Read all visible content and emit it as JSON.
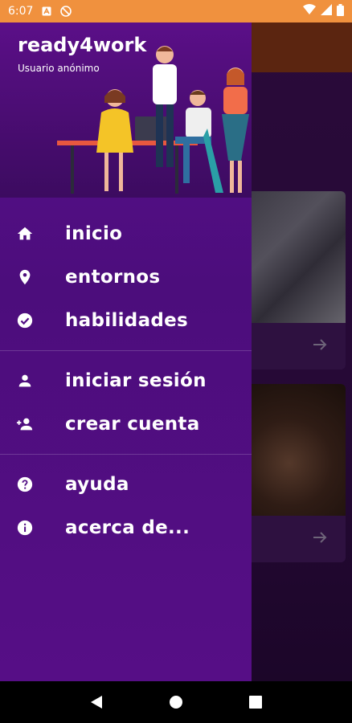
{
  "status_bar": {
    "time": "6:07",
    "left_icons": [
      "sim-a-icon",
      "no-disturb-icon"
    ],
    "right_icons": [
      "wifi-icon",
      "signal-icon",
      "battery-icon"
    ],
    "bg_color": "#f0913e"
  },
  "drawer": {
    "app_title": "ready4work",
    "user_label": "Usuario anónimo",
    "sections": [
      [
        {
          "label": "inicio",
          "icon": "home-icon"
        },
        {
          "label": "entornos",
          "icon": "location-pin-icon"
        },
        {
          "label": "habilidades",
          "icon": "check-circle-icon"
        }
      ],
      [
        {
          "label": "iniciar sesión",
          "icon": "person-icon"
        },
        {
          "label": "crear cuenta",
          "icon": "person-add-icon"
        }
      ],
      [
        {
          "label": "ayuda",
          "icon": "help-circle-icon"
        },
        {
          "label": "acerca de...",
          "icon": "info-circle-icon"
        }
      ]
    ],
    "bg_color": "#520e85"
  },
  "navigation_bar": {
    "buttons": [
      "back-icon",
      "home-icon",
      "recents-icon"
    ]
  }
}
